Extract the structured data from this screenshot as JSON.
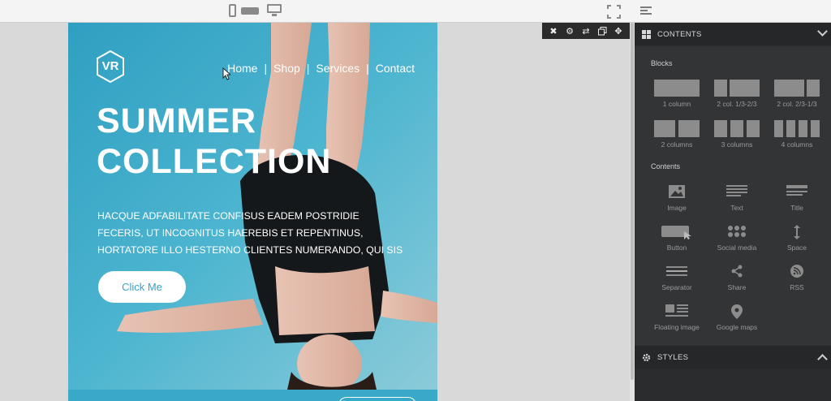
{
  "hero": {
    "logo": "VR",
    "nav": [
      "Home",
      "Shop",
      "Services",
      "Contact"
    ],
    "nav_separator": "|",
    "headline_line1": "SUMMER",
    "headline_line2": "COLLECTION",
    "body_line1": "HACQUE ADFABILITATE CONFISUS EADEM POSTRIDIE",
    "body_line2": "FECERIS, UT INCOGNITUS HAEREBIS ET REPENTINUS,",
    "body_line3": "HORTATORE ILLO HESTERNO CLIENTES NUMERANDO, QUI SIS",
    "cta_label": "Click Me",
    "background_color": "#45b1ce",
    "cta_text_color": "#3aa3c3"
  },
  "block_toolbar": {
    "icons": [
      "close-icon",
      "gear-icon",
      "swap-icon",
      "duplicate-icon",
      "move-icon"
    ]
  },
  "topbar": {
    "devices": [
      "phone-icon",
      "tablet-icon",
      "desktop-icon"
    ],
    "fullscreen_icon": "fullscreen-icon"
  },
  "panel": {
    "contents_title": "CONTENTS",
    "blocks_heading": "Blocks",
    "blocks": [
      {
        "label": "1 column",
        "cols": 1
      },
      {
        "label": "2 col. 1/3-2/3",
        "cols": 2
      },
      {
        "label": "2 col. 2/3-1/3",
        "cols": 2
      },
      {
        "label": "2 columns",
        "cols": 2
      },
      {
        "label": "3 columns",
        "cols": 3
      },
      {
        "label": "4 columns",
        "cols": 4
      }
    ],
    "contents_heading": "Contents",
    "contents": [
      {
        "label": "Image",
        "icon": "image-icon"
      },
      {
        "label": "Text",
        "icon": "text-icon"
      },
      {
        "label": "Title",
        "icon": "title-icon"
      },
      {
        "label": "Button",
        "icon": "button-icon"
      },
      {
        "label": "Social media",
        "icon": "social-media-icon"
      },
      {
        "label": "Space",
        "icon": "space-icon"
      },
      {
        "label": "Separator",
        "icon": "separator-icon"
      },
      {
        "label": "Share",
        "icon": "share-icon"
      },
      {
        "label": "RSS",
        "icon": "rss-icon"
      },
      {
        "label": "Floating image",
        "icon": "floating-image-icon"
      },
      {
        "label": "Google maps",
        "icon": "map-pin-icon"
      }
    ],
    "styles_title": "STYLES",
    "panel_bg": "#333436",
    "header_bg": "#262729"
  }
}
